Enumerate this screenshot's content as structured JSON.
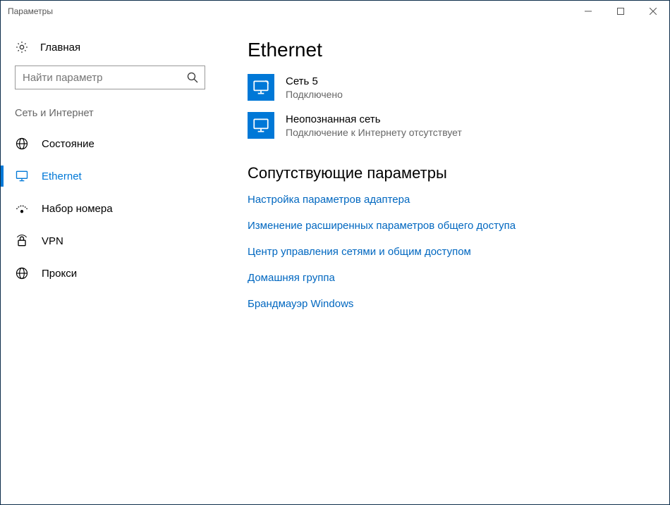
{
  "window": {
    "title": "Параметры"
  },
  "sidebar": {
    "home_label": "Главная",
    "search_placeholder": "Найти параметр",
    "category_label": "Сеть и Интернет",
    "items": [
      {
        "label": "Состояние"
      },
      {
        "label": "Ethernet"
      },
      {
        "label": "Набор номера"
      },
      {
        "label": "VPN"
      },
      {
        "label": "Прокси"
      }
    ]
  },
  "main": {
    "title": "Ethernet",
    "networks": [
      {
        "name": "Сеть  5",
        "status": "Подключено"
      },
      {
        "name": "Неопознанная сеть",
        "status": "Подключение к Интернету отсутствует"
      }
    ],
    "related_title": "Сопутствующие параметры",
    "links": [
      "Настройка параметров адаптера",
      "Изменение расширенных параметров общего доступа",
      "Центр управления сетями и общим доступом",
      "Домашняя группа",
      "Брандмауэр Windows"
    ]
  }
}
